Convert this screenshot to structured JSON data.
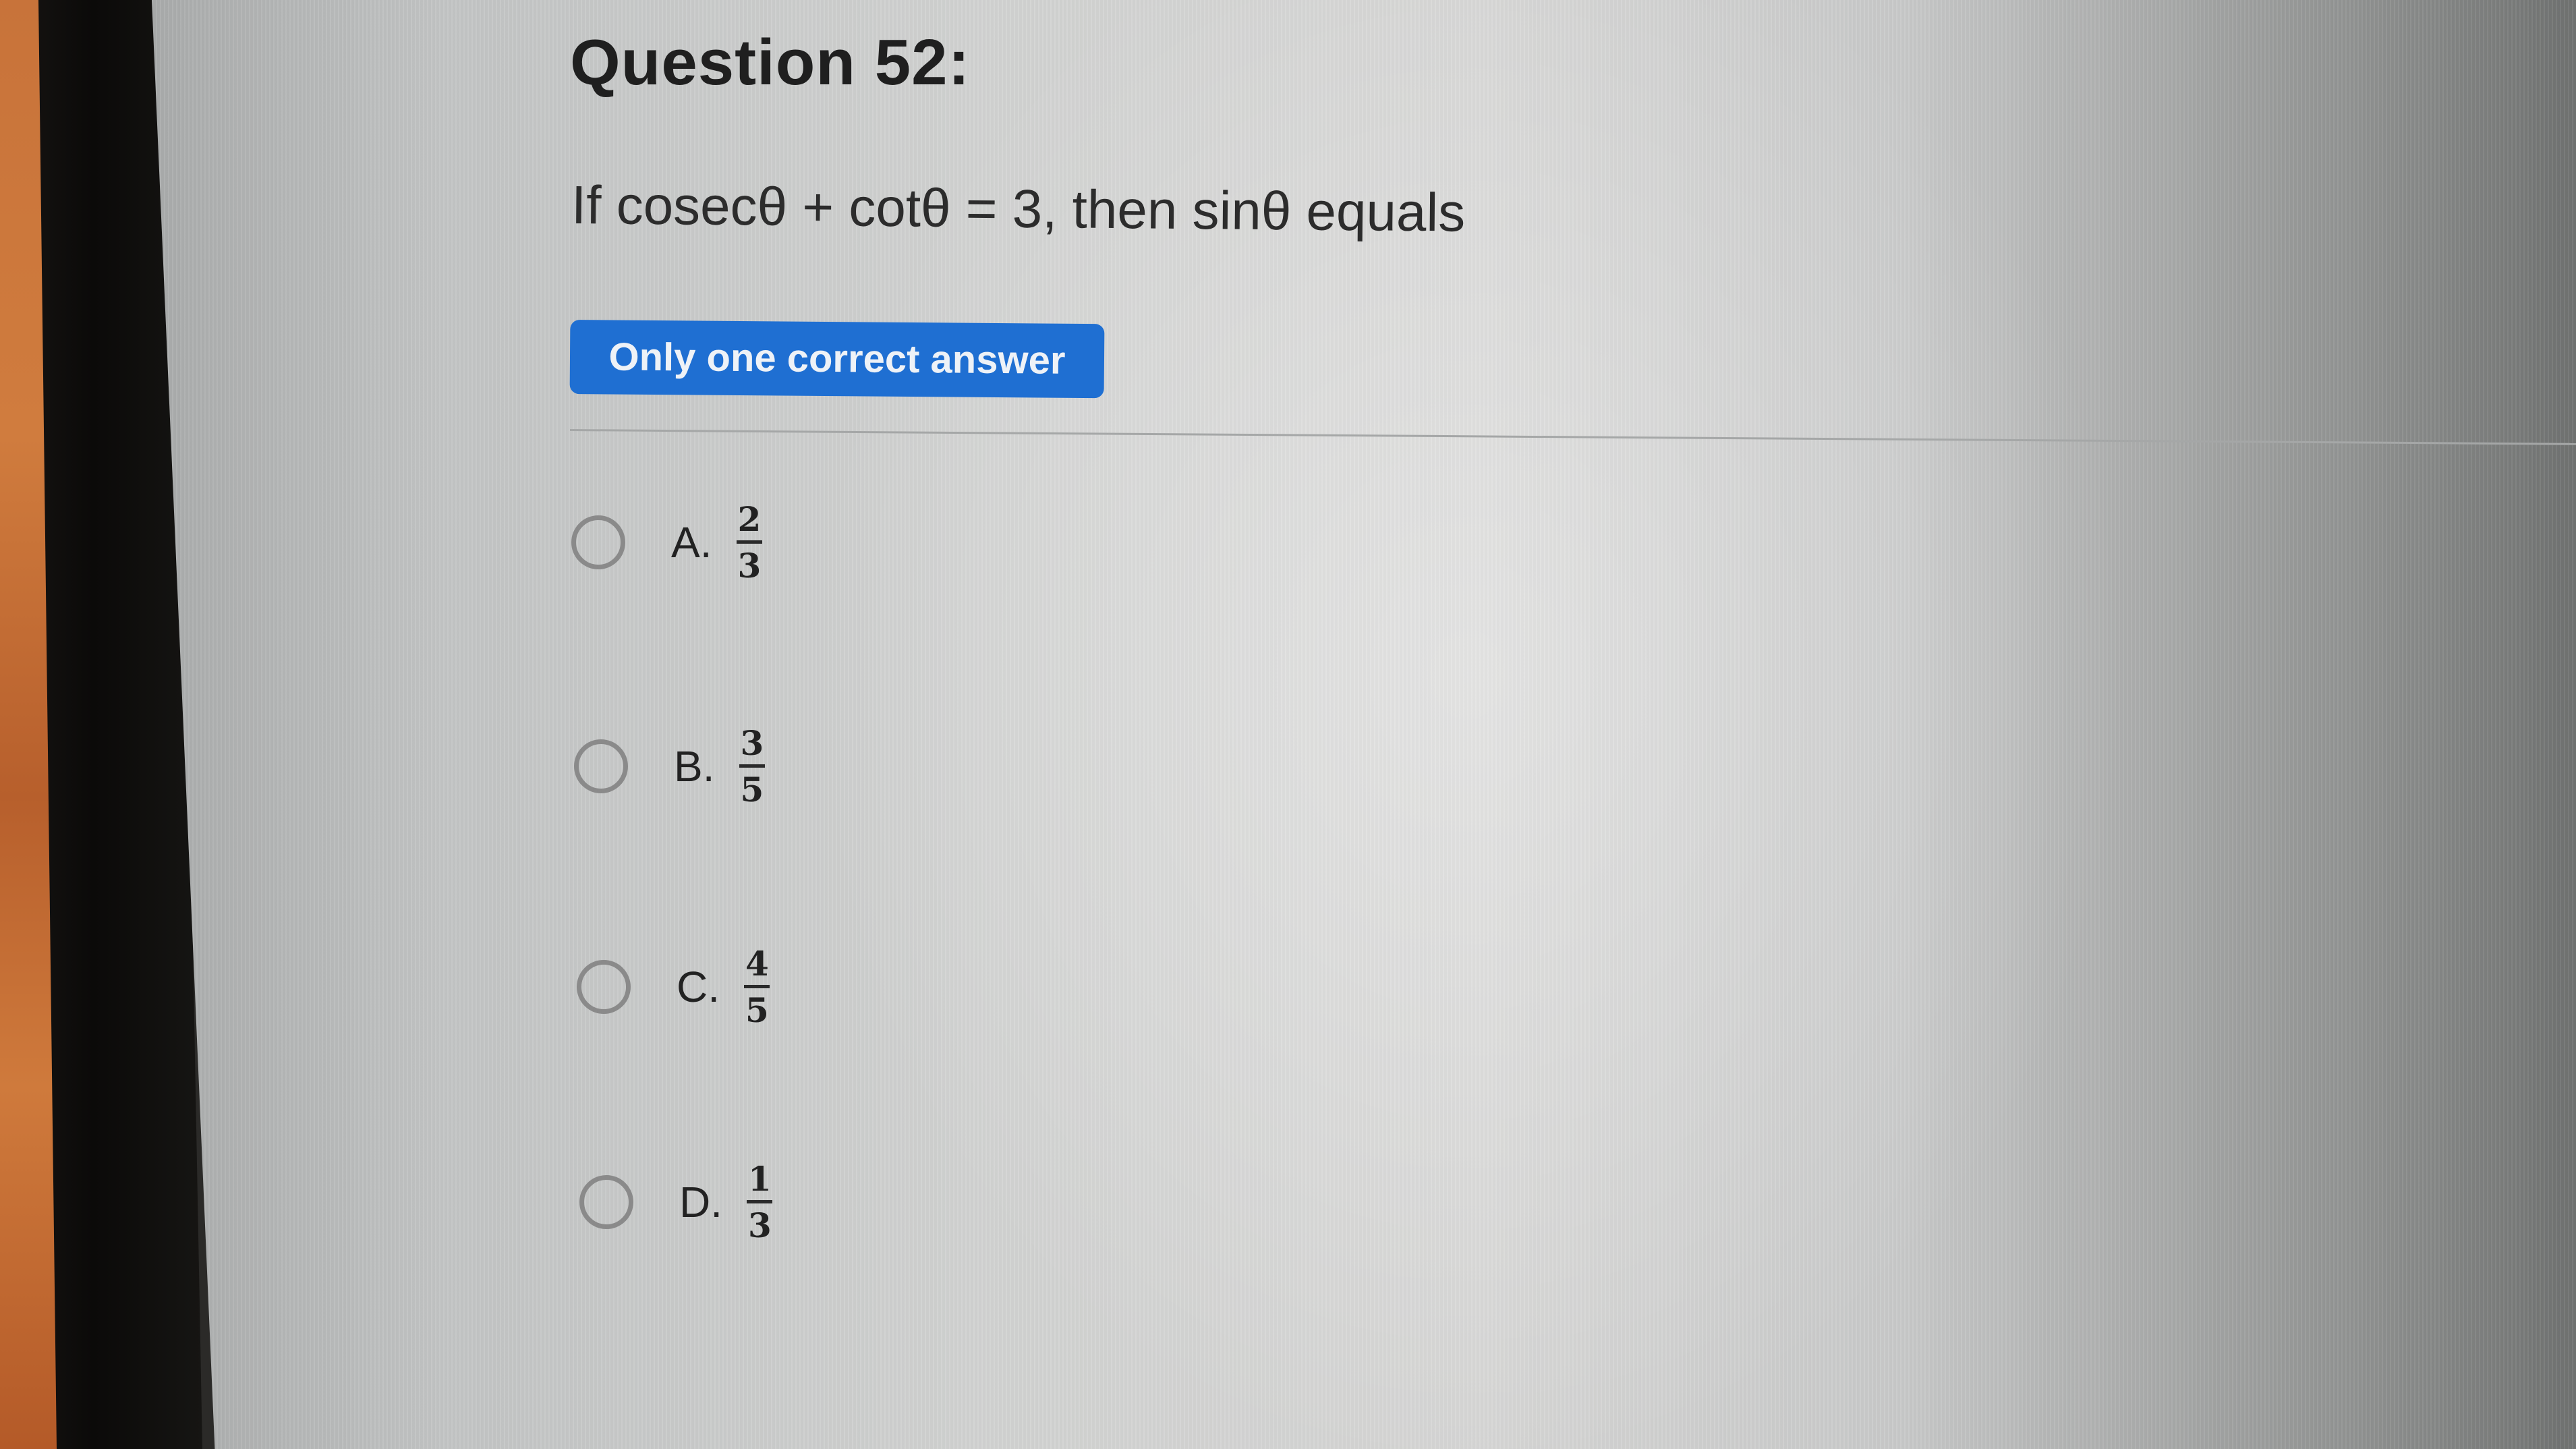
{
  "question": {
    "title": "Question 52:",
    "text": "If cosecθ + cotθ = 3, then sinθ equals",
    "answer_type_badge": "Only one correct answer"
  },
  "options": [
    {
      "letter": "A.",
      "numerator": "2",
      "denominator": "3",
      "selected": false
    },
    {
      "letter": "B.",
      "numerator": "3",
      "denominator": "5",
      "selected": false
    },
    {
      "letter": "C.",
      "numerator": "4",
      "denominator": "5",
      "selected": false
    },
    {
      "letter": "D.",
      "numerator": "1",
      "denominator": "3",
      "selected": false
    }
  ],
  "colors": {
    "badge_bg": "#1f6fd2",
    "badge_text": "#eef2f7",
    "radio_border": "#8a8a8a",
    "text": "#222222"
  }
}
